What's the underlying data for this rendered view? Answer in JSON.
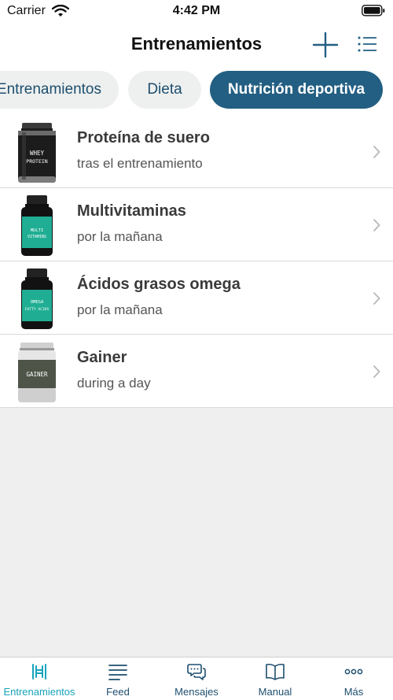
{
  "status_bar": {
    "carrier": "Carrier",
    "time": "4:42 PM"
  },
  "nav": {
    "title": "Entrenamientos"
  },
  "tabs": [
    {
      "label": "Entrenamientos",
      "active": false
    },
    {
      "label": "Dieta",
      "active": false
    },
    {
      "label": "Nutrición deportiva",
      "active": true
    }
  ],
  "items": [
    {
      "title": "Proteína de suero",
      "subtitle": "tras el entrenamiento",
      "image_label": [
        "WHEY",
        "PROTEIN"
      ],
      "image": "whey-protein-jar"
    },
    {
      "title": "Multivitaminas",
      "subtitle": "por la mañana",
      "image_label": [
        "MULTI",
        "VITAMINS"
      ],
      "image": "multivitamin-bottle"
    },
    {
      "title": "Ácidos grasos omega",
      "subtitle": "por la mañana",
      "image_label": [
        "OMEGA",
        "FATTY ACIDS"
      ],
      "image": "omega-bottle"
    },
    {
      "title": "Gainer",
      "subtitle": "during a day",
      "image_label": [
        "GAINER"
      ],
      "image": "gainer-jar"
    }
  ],
  "tab_bar": [
    {
      "label": "Entrenamientos",
      "icon": "dumbbell-icon",
      "active": true
    },
    {
      "label": "Feed",
      "icon": "feed-icon",
      "active": false
    },
    {
      "label": "Mensajes",
      "icon": "messages-icon",
      "active": false
    },
    {
      "label": "Manual",
      "icon": "book-icon",
      "active": false
    },
    {
      "label": "Más",
      "icon": "more-icon",
      "active": false
    }
  ],
  "colors": {
    "accent": "#235f82",
    "tab_bar_active": "#17a3bb",
    "tab_bar_inactive": "#1d4e6e",
    "background": "#efefef"
  }
}
